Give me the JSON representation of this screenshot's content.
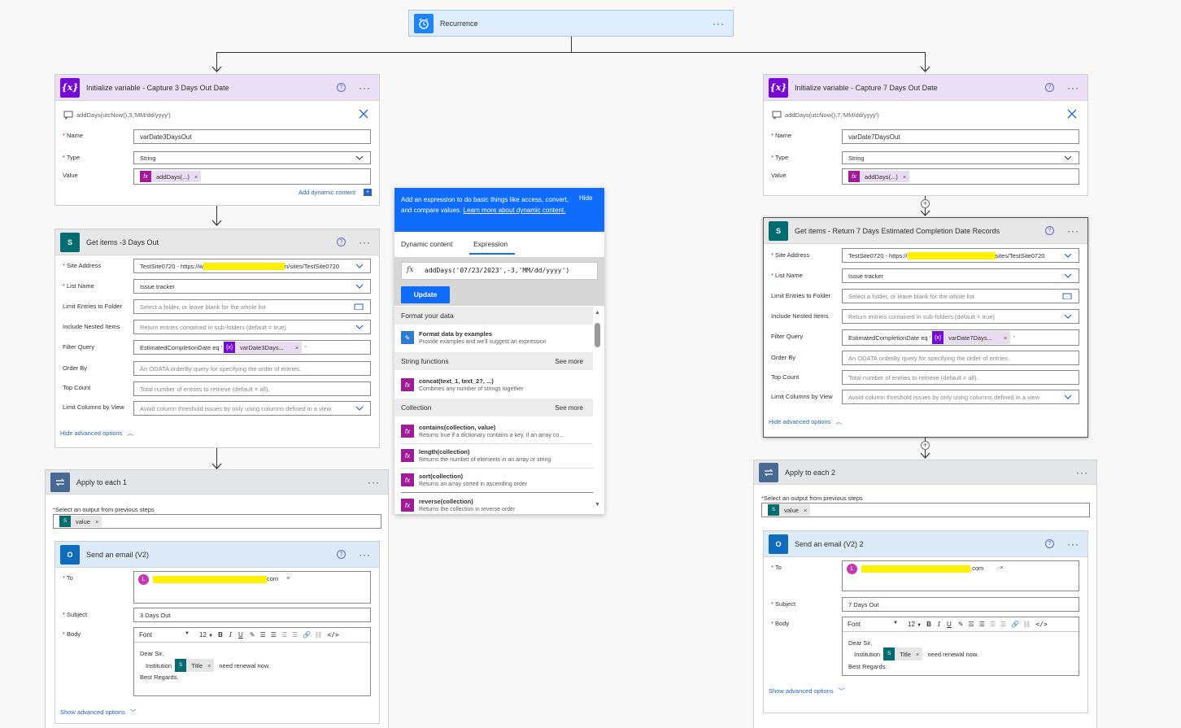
{
  "recurrence": {
    "title": "Recurrence"
  },
  "init3": {
    "title": "Initialize variable - Capture 3 Days Out Date",
    "formula_label": "addDays(utcNow(),3,'MM/dd/yyyy')",
    "name_label": "Name",
    "name_value": "varDate3DaysOut",
    "type_label": "Type",
    "type_value": "String",
    "value_label": "Value",
    "value_token": "addDays(...)",
    "add_dynamic": "Add dynamic content"
  },
  "get3": {
    "title": "Get items -3 Days Out",
    "site_label": "Site Address",
    "site_value_a": "TestSite0720 - https://w",
    "site_value_b": "n/sites/TestSite0720",
    "list_label": "List Name",
    "list_value": "Issue tracker",
    "limit_label": "Limit Entries to Folder",
    "limit_ph": "Select a folder, or leave blank for the whole list",
    "nested_label": "Include Nested Items",
    "nested_ph": "Return entries contained in sub-folders (default = true)",
    "filter_label": "Filter Query",
    "filter_value": "EstimatedCompletionDate eq '",
    "filter_token": "varDate3Days...",
    "filter_end": "'",
    "order_label": "Order By",
    "order_ph": "An ODATA orderBy query for specifying the order of entries.",
    "top_label": "Top Count",
    "top_ph": "Total number of entries to retrieve (default = all).",
    "cols_label": "Limit Columns by View",
    "cols_ph": "Avoid column threshold issues by only using columns defined in a view",
    "hide_adv": "Hide advanced options"
  },
  "apply1": {
    "title": "Apply to each 1",
    "select_label": "Select an output from previous steps",
    "value_token": "value"
  },
  "email1": {
    "title": "Send an email (V2)",
    "to_label": "To",
    "to_suffix": "com",
    "subject_label": "Subject",
    "subject_value": "3 Days Out",
    "body_label": "Body",
    "font": "Font",
    "size": "12",
    "body_line1": "Dear Sir,",
    "body_line2": "Institution",
    "body_token": "Title",
    "body_line2_end": "need renewal now.",
    "body_line3": "Best Regards.",
    "show_adv": "Show advanced options"
  },
  "init7": {
    "title": "Initialize variable - Capture 7 Days Out Date",
    "formula_label": "addDays(utcNow(),7,'MM/dd/yyyy')",
    "name_label": "Name",
    "name_value": "varDate7DaysOut",
    "type_label": "Type",
    "type_value": "String",
    "value_label": "Value",
    "value_token": "addDays(...)"
  },
  "get7": {
    "title": "Get items - Return 7 Days Estimated Completion Date Records",
    "site_label": "Site Address",
    "site_value_a": "TestSite0720 - https://",
    "site_value_b": "sites/TestSite0720",
    "list_label": "List Name",
    "list_value": "Issue tracker",
    "limit_label": "Limit Entries to Folder",
    "limit_ph": "Select a folder, or leave blank for the whole list",
    "nested_label": "Include Nested Items",
    "nested_ph": "Return entries contained in sub-folders (default = true)",
    "filter_label": "Filter Query",
    "filter_value": "EstimatedCompletionDate eq '",
    "filter_token": "varDate7Days...",
    "filter_end": "'",
    "order_label": "Order By",
    "order_ph": "An ODATA orderBy query for specifying the order of entries.",
    "top_label": "Top Count",
    "top_ph": "Total number of entries to retrieve (default = all).",
    "cols_label": "Limit Columns by View",
    "cols_ph": "Avoid column threshold issues by only using columns defined in a view",
    "hide_adv": "Hide advanced options"
  },
  "apply2": {
    "title": "Apply to each 2",
    "select_label": "Select an output from previous steps",
    "value_token": "value"
  },
  "email2": {
    "title": "Send an email (V2) 2",
    "to_label": "To",
    "to_suffix": ".com",
    "subject_label": "Subject",
    "subject_value": "7 Days Out",
    "body_label": "Body",
    "font": "Font",
    "size": "12",
    "body_line1": "Dear Sir,",
    "body_line2": "Institution",
    "body_token": "Title",
    "body_line2_end": "need renewal now.",
    "body_line3": "Best Regards.",
    "show_adv": "Show advanced options"
  },
  "expr": {
    "banner_text": "Add an expression to do basic things like access, convert, and compare values.",
    "learn_more": "Learn more about dynamic content.",
    "hide": "Hide",
    "tab_dynamic": "Dynamic content",
    "tab_expression": "Expression",
    "fx": "fx",
    "expression_value": "addDays('07/23/2023',-3,'MM/dd/yyyy')",
    "update": "Update",
    "sec_format": "Format your data",
    "format_name": "Format data by examples",
    "format_desc": "Provide examples and we'll suggest an expression",
    "sec_string": "String functions",
    "see_more": "See more",
    "concat_name": "concat(text_1, text_2?, ...)",
    "concat_desc": "Combines any number of strings together",
    "sec_collection": "Collection",
    "contains_name": "contains(collection, value)",
    "contains_desc": "Returns true if a dictionary contains a key, if an array co...",
    "length_name": "length(collection)",
    "length_desc": "Returns the number of elements in an array or string",
    "sort_name": "sort(collection)",
    "sort_desc": "Returns an array sorted in ascending order",
    "reverse_name": "reverse(collection)",
    "reverse_desc": "Returns the collection in reverse order"
  },
  "colors": {
    "accent": "#0078d4",
    "variable": "#770bd6",
    "sharepoint": "#036c70",
    "outlook": "#0f6cbd",
    "expression": "#a21999"
  }
}
